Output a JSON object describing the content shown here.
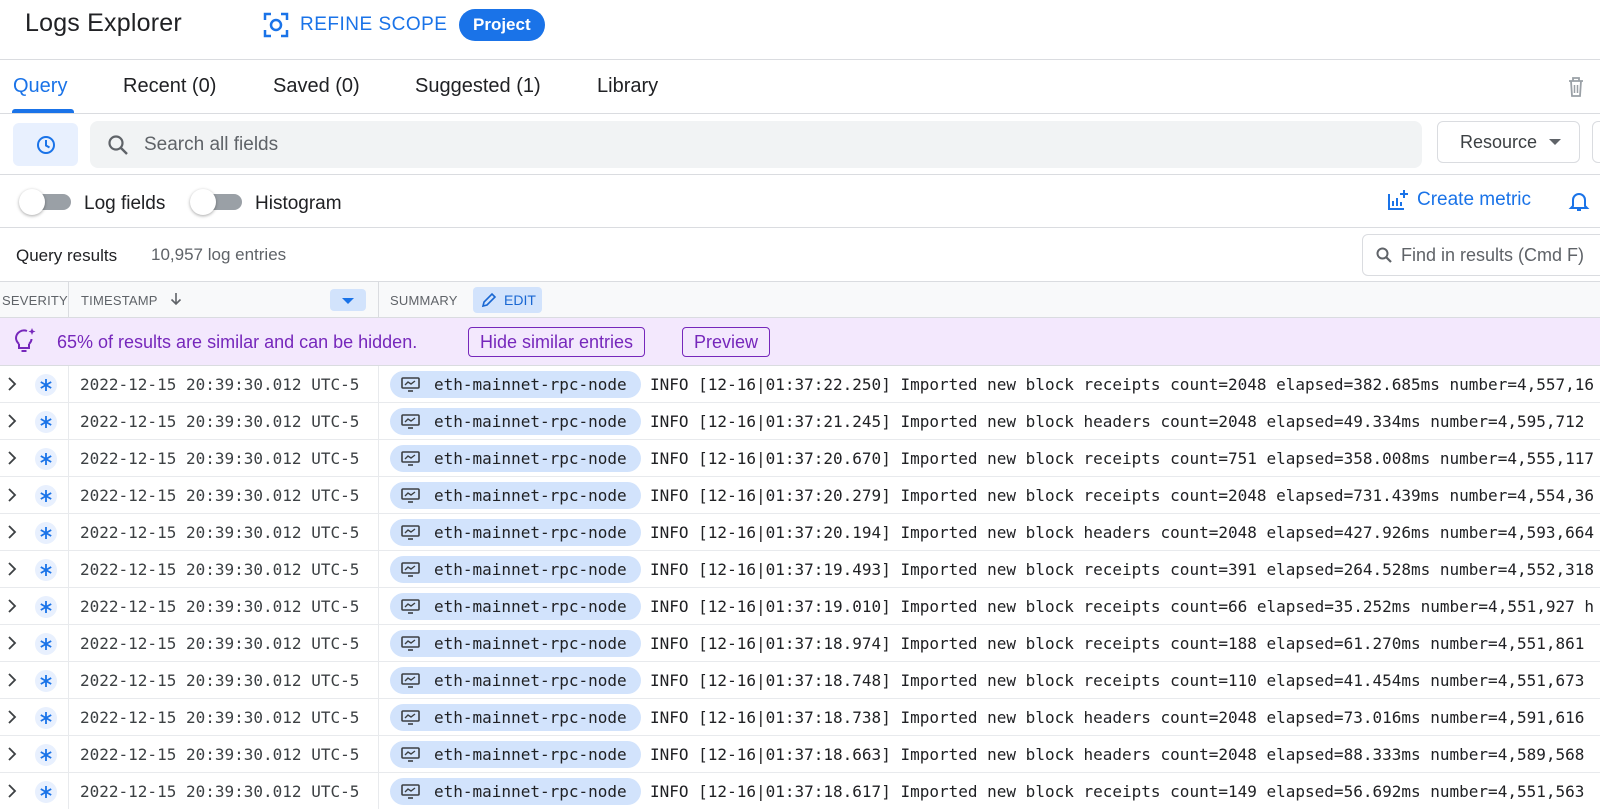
{
  "header": {
    "title": "Logs Explorer",
    "refine_label": "REFINE SCOPE",
    "project_chip": "Project"
  },
  "tabs": [
    {
      "label": "Query",
      "active": true
    },
    {
      "label": "Recent (0)",
      "active": false
    },
    {
      "label": "Saved (0)",
      "active": false
    },
    {
      "label": "Suggested (1)",
      "active": false
    },
    {
      "label": "Library",
      "active": false
    }
  ],
  "search": {
    "placeholder": "Search all fields",
    "resource_label": "Resource"
  },
  "toggles": {
    "log_fields_label": "Log fields",
    "histogram_label": "Histogram",
    "create_metric_label": "Create metric"
  },
  "results": {
    "title": "Query results",
    "count": "10,957 log entries",
    "find_placeholder": "Find in results (Cmd F)"
  },
  "columns": {
    "severity": "SEVERITY",
    "timestamp": "TIMESTAMP",
    "summary": "SUMMARY",
    "edit_label": "EDIT"
  },
  "banner": {
    "text": "65% of results are similar and can be hidden.",
    "hide_label": "Hide similar entries",
    "preview_label": "Preview"
  },
  "colors": {
    "accent": "#1a73e8",
    "banner_bg": "#f3e8fd",
    "banner_text": "#7627bb"
  },
  "rows": [
    {
      "timestamp": "2022-12-15 20:39:30.012 UTC-5",
      "resource": "eth-mainnet-rpc-node",
      "summary": "INFO [12-16|01:37:22.250] Imported new block receipts count=2048 elapsed=382.685ms number=4,557,16"
    },
    {
      "timestamp": "2022-12-15 20:39:30.012 UTC-5",
      "resource": "eth-mainnet-rpc-node",
      "summary": "INFO [12-16|01:37:21.245] Imported new block headers count=2048 elapsed=49.334ms number=4,595,712"
    },
    {
      "timestamp": "2022-12-15 20:39:30.012 UTC-5",
      "resource": "eth-mainnet-rpc-node",
      "summary": "INFO [12-16|01:37:20.670] Imported new block receipts count=751 elapsed=358.008ms number=4,555,117"
    },
    {
      "timestamp": "2022-12-15 20:39:30.012 UTC-5",
      "resource": "eth-mainnet-rpc-node",
      "summary": "INFO [12-16|01:37:20.279] Imported new block receipts count=2048 elapsed=731.439ms number=4,554,36"
    },
    {
      "timestamp": "2022-12-15 20:39:30.012 UTC-5",
      "resource": "eth-mainnet-rpc-node",
      "summary": "INFO [12-16|01:37:20.194] Imported new block headers count=2048 elapsed=427.926ms number=4,593,664"
    },
    {
      "timestamp": "2022-12-15 20:39:30.012 UTC-5",
      "resource": "eth-mainnet-rpc-node",
      "summary": "INFO [12-16|01:37:19.493] Imported new block receipts count=391 elapsed=264.528ms number=4,552,318"
    },
    {
      "timestamp": "2022-12-15 20:39:30.012 UTC-5",
      "resource": "eth-mainnet-rpc-node",
      "summary": "INFO [12-16|01:37:19.010] Imported new block receipts count=66 elapsed=35.252ms number=4,551,927 h"
    },
    {
      "timestamp": "2022-12-15 20:39:30.012 UTC-5",
      "resource": "eth-mainnet-rpc-node",
      "summary": "INFO [12-16|01:37:18.974] Imported new block receipts count=188 elapsed=61.270ms number=4,551,861"
    },
    {
      "timestamp": "2022-12-15 20:39:30.012 UTC-5",
      "resource": "eth-mainnet-rpc-node",
      "summary": "INFO [12-16|01:37:18.748] Imported new block receipts count=110 elapsed=41.454ms number=4,551,673"
    },
    {
      "timestamp": "2022-12-15 20:39:30.012 UTC-5",
      "resource": "eth-mainnet-rpc-node",
      "summary": "INFO [12-16|01:37:18.738] Imported new block headers count=2048 elapsed=73.016ms number=4,591,616"
    },
    {
      "timestamp": "2022-12-15 20:39:30.012 UTC-5",
      "resource": "eth-mainnet-rpc-node",
      "summary": "INFO [12-16|01:37:18.663] Imported new block headers count=2048 elapsed=88.333ms number=4,589,568"
    },
    {
      "timestamp": "2022-12-15 20:39:30.012 UTC-5",
      "resource": "eth-mainnet-rpc-node",
      "summary": "INFO [12-16|01:37:18.617] Imported new block receipts count=149 elapsed=56.692ms number=4,551,563"
    }
  ]
}
